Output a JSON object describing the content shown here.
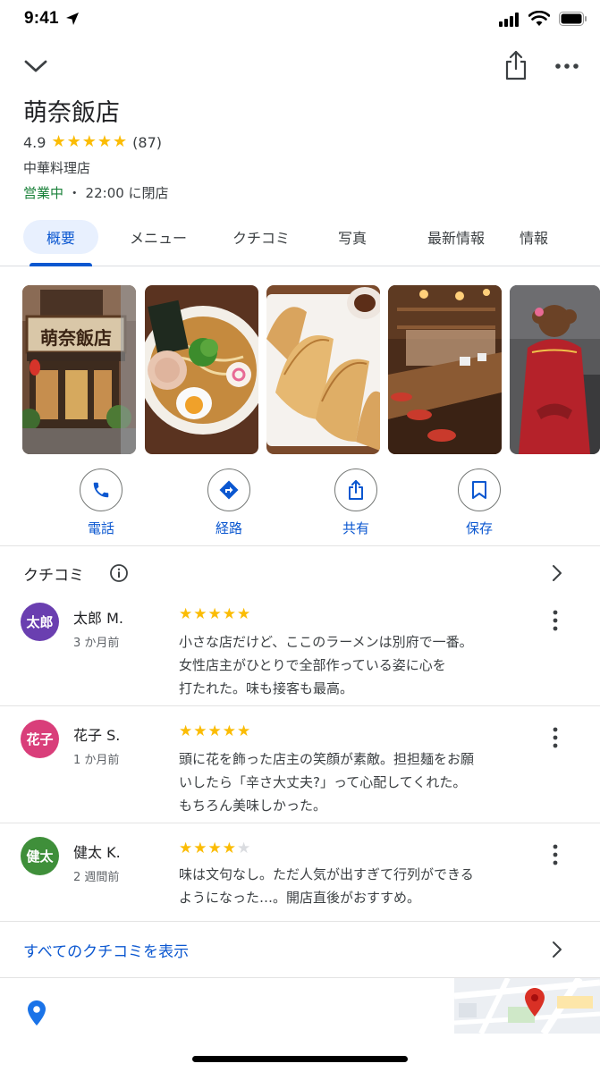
{
  "status_bar": {
    "time": "9:41"
  },
  "place": {
    "name": "萌奈飯店",
    "rating": "4.9",
    "rating_value": 4.9,
    "review_count": "(87)",
    "category": "中華料理店",
    "open_status": "営業中",
    "hours_detail": " ・ 22:00 に閉店"
  },
  "tabs": [
    {
      "label": "概要",
      "active": true
    },
    {
      "label": "メニュー",
      "active": false
    },
    {
      "label": "クチコミ",
      "active": false
    },
    {
      "label": "写真",
      "active": false
    },
    {
      "label": "最新情報",
      "active": false
    },
    {
      "label": "情報",
      "active": false
    }
  ],
  "actions": [
    {
      "label": "電話",
      "icon": "phone-icon"
    },
    {
      "label": "経路",
      "icon": "directions-icon"
    },
    {
      "label": "共有",
      "icon": "share-icon"
    },
    {
      "label": "保存",
      "icon": "bookmark-icon"
    }
  ],
  "reviews_section": {
    "title": "クチコミ",
    "items": [
      {
        "avatar_text": "太郎",
        "avatar_color": "#6a3fb0",
        "name": "太郎 M.",
        "time": "3 か月前",
        "stars": 5,
        "lines": [
          "小さな店だけど、ここのラーメンは別府で一番。",
          "女性店主がひとりで全部作っている姿に心を",
          "打たれた。味も接客も最高。"
        ]
      },
      {
        "avatar_text": "花子",
        "avatar_color": "#d93e7a",
        "name": "花子 S.",
        "time": "1 か月前",
        "stars": 5,
        "lines": [
          "頭に花を飾った店主の笑顔が素敵。担担麺をお願",
          "いしたら「辛さ大丈夫?」って心配してくれた。",
          "もちろん美味しかった。"
        ]
      },
      {
        "avatar_text": "健太",
        "avatar_color": "#3f8f3a",
        "name": "健太 K.",
        "time": "2 週間前",
        "stars": 4,
        "lines": [
          "味は文句なし。ただ人気が出すぎて行列ができる",
          "ようになった…。開店直後がおすすめ。"
        ]
      }
    ],
    "all_reviews_label": "すべてのクチコミを表示"
  },
  "colors": {
    "accent": "#0b57d0",
    "open_green": "#188038",
    "star": "#fbbc04",
    "map_pin": "#d93025"
  },
  "photos": [
    "restaurant-exterior",
    "ramen-bowl",
    "gyoza-plate",
    "restaurant-counter",
    "chef-at-stove"
  ]
}
